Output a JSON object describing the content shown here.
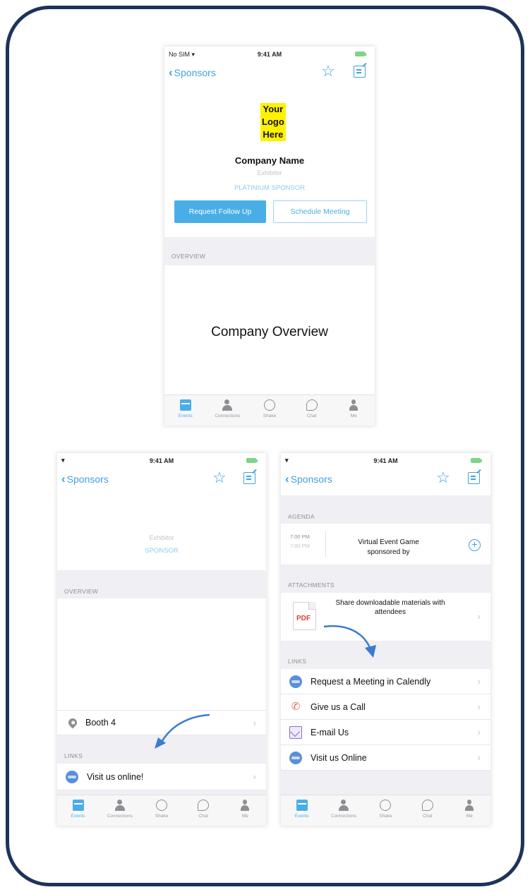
{
  "colors": {
    "frame_border": "#1e3358",
    "ios_blue": "#3fa3de",
    "button_blue": "#4aaee6",
    "logo_yellow": "#fff200",
    "group_bg": "#efeff4",
    "arrow_blue": "#3b7bd1"
  },
  "status": {
    "carrier": "No SIM",
    "time": "9:41 AM"
  },
  "nav": {
    "back_label": "Sponsors",
    "star_icon": "star-outline-icon",
    "note_icon": "compose-icon"
  },
  "top_screen": {
    "logo_lines": [
      "Your",
      "Logo",
      "Here"
    ],
    "company_name": "Company Name",
    "exhibitor": "Exhibitor",
    "tier": "PLATINIUM SPONSOR",
    "request_button": "Request Follow Up",
    "schedule_button": "Schedule Meeting",
    "overview_header": "OVERVIEW",
    "overview_text": "Company Overview"
  },
  "bottom_left": {
    "exhibitor": "Exhibitor",
    "tier": "SPONSOR",
    "overview_header": "OVERVIEW",
    "booth": "Booth 4",
    "links_header": "LINKS",
    "visit_link": "Visit us online!"
  },
  "bottom_right": {
    "agenda_header": "AGENDA",
    "agenda_time_start": "7:00 PM",
    "agenda_time_end": "7:00 PM",
    "agenda_title": "Virtual Event Game sponsored by",
    "attachments_header": "ATTACHMENTS",
    "pdf_label": "PDF",
    "attachment_text": "Share downloadable materials with attendees",
    "links_header": "LINKS",
    "links": [
      {
        "label": "Request a Meeting in Calendly",
        "icon": "globe-icon"
      },
      {
        "label": "Give us a Call",
        "icon": "phone-icon"
      },
      {
        "label": "E-mail Us",
        "icon": "mail-icon"
      },
      {
        "label": "Visit us Online",
        "icon": "globe-icon"
      }
    ]
  },
  "tabs": [
    {
      "label": "Events",
      "icon": "calendar-icon",
      "active": true
    },
    {
      "label": "Connections",
      "icon": "people-icon",
      "active": false
    },
    {
      "label": "Shake",
      "icon": "shake-icon",
      "active": false
    },
    {
      "label": "Chat",
      "icon": "chat-icon",
      "active": false
    },
    {
      "label": "Me",
      "icon": "person-icon",
      "active": false
    }
  ]
}
